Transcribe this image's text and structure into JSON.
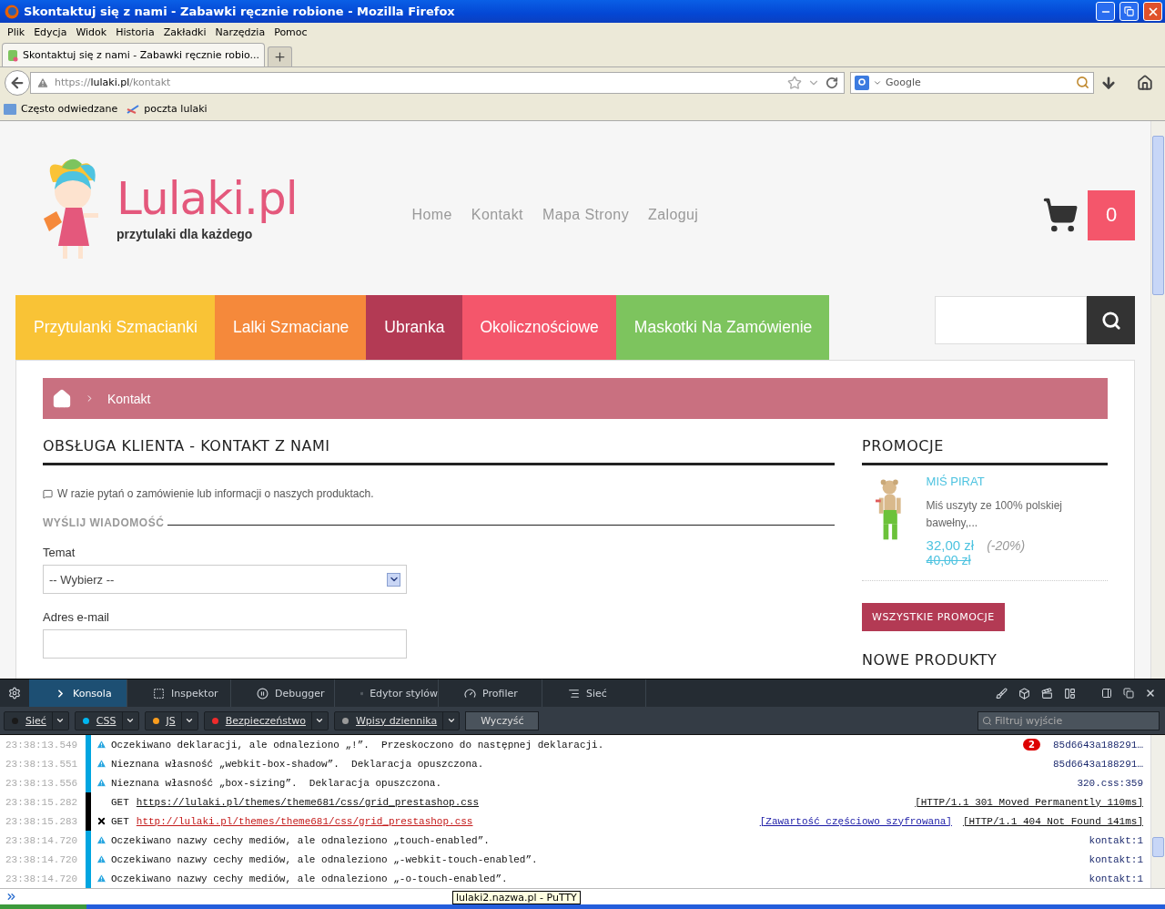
{
  "window": {
    "title": "Skontaktuj się z nami - Zabawki ręcznie robione - Mozilla Firefox"
  },
  "menu": [
    "Plik",
    "Edycja",
    "Widok",
    "Historia",
    "Zakładki",
    "Narzędzia",
    "Pomoc"
  ],
  "tabs": [
    {
      "label": "Skontaktuj się z nami - Zabawki ręcznie robio...",
      "selected": true
    }
  ],
  "address_bar": {
    "scheme": "https://",
    "host": "lulaki.pl",
    "path": "/kontakt"
  },
  "search_bar": {
    "placeholder": "Google"
  },
  "bookmarks": [
    "Często odwiedzane",
    "poczta lulaki"
  ],
  "page": {
    "logo": {
      "name": "Lulaki.pl",
      "tagline": "przytulaki dla każdego"
    },
    "nav": [
      "Home",
      "Kontakt",
      "Mapa Strony",
      "Zaloguj"
    ],
    "cart_count": "0",
    "categories": [
      {
        "label": "Przytulanki Szmacianki",
        "color": "#f9c336"
      },
      {
        "label": "Lalki Szmaciane",
        "color": "#f5893b"
      },
      {
        "label": "Ubranka",
        "color": "#b33a54"
      },
      {
        "label": "Okolicznościowe",
        "color": "#f4566b"
      },
      {
        "label": "Maskotki Na Zamówienie",
        "color": "#7dc45e"
      }
    ],
    "breadcrumb": [
      "Kontakt"
    ],
    "heading": "OBSŁUGA KLIENTA - KONTAKT Z NAMI",
    "intro": "W razie pytań o zamówienie lub informacji o naszych produktach.",
    "form_section": "WYŚLIJ WIADOMOŚĆ",
    "fields": [
      {
        "kind": "select",
        "label": "Temat",
        "value": "-- Wybierz --"
      },
      {
        "kind": "text",
        "label": "Adres e-mail"
      }
    ],
    "sidebar": {
      "title": "PROMOCJE",
      "product": {
        "name": "MIŚ PIRAT",
        "description": "Miś uszyty ze 100% polskiej bawełny,...",
        "price": "32,00 zł",
        "discount": "(-20%)",
        "old_price": "40,00 zł"
      },
      "button": "WSZYSTKIE PROMOCJE",
      "next_title": "NOWE PRODUKTY"
    }
  },
  "devtools": {
    "tabs": [
      {
        "label": "Konsola",
        "selected": true
      },
      {
        "label": "Inspektor",
        "selected": false
      },
      {
        "label": "Debugger",
        "selected": false
      },
      {
        "label": "Edytor stylów",
        "selected": false
      },
      {
        "label": "Profiler",
        "selected": false
      },
      {
        "label": "Sieć",
        "selected": false
      }
    ],
    "filters": [
      {
        "label": "Sieć",
        "color": "#1a1a1a"
      },
      {
        "label": "CSS",
        "color": "#00b6f0"
      },
      {
        "label": "JS",
        "color": "#fa9d1e"
      },
      {
        "label": "Bezpieczeństwo",
        "color": "#ef2b2b"
      },
      {
        "label": "Wpisy dziennika",
        "color": "#9a9a9a"
      }
    ],
    "clear": "Wyczyść",
    "filter_placeholder": "Filtruj wyjście",
    "rows": [
      {
        "kind": "warning",
        "time": "23:38:13.549",
        "message": "Oczekiwano deklaracji, ale odnaleziono „!”.  Przeskoczono do następnej deklaracji.",
        "badge": "2",
        "source": "85d6643a188291…"
      },
      {
        "kind": "warning",
        "time": "23:38:13.551",
        "message": "Nieznana własność „webkit-box-shadow”.  Deklaracja opuszczona.",
        "source": "85d6643a188291…"
      },
      {
        "kind": "warning",
        "time": "23:38:13.556",
        "message": "Nieznana własność „box-sizing”.  Deklaracja opuszczona.",
        "source": "320.css:359"
      },
      {
        "kind": "network",
        "time": "23:38:15.282",
        "method": "GET",
        "url": "https://lulaki.pl/themes/theme681/css/grid_prestashop.css",
        "status": "[HTTP/1.1 301 Moved Permanently 110ms]"
      },
      {
        "kind": "network-error",
        "time": "23:38:15.283",
        "method": "GET",
        "url": "http://lulaki.pl/themes/theme681/css/grid_prestashop.css",
        "note": "[Zawartość częściowo szyfrowana]",
        "status": "[HTTP/1.1 404 Not Found 141ms]"
      },
      {
        "kind": "warning",
        "time": "23:38:14.720",
        "message": "Oczekiwano nazwy cechy mediów, ale odnaleziono „touch-enabled”.",
        "source": "kontakt:1"
      },
      {
        "kind": "warning",
        "time": "23:38:14.720",
        "message": "Oczekiwano nazwy cechy mediów, ale odnaleziono „-webkit-touch-enabled”.",
        "source": "kontakt:1"
      },
      {
        "kind": "warning",
        "time": "23:38:14.720",
        "message": "Oczekiwano nazwy cechy mediów, ale odnaleziono „-o-touch-enabled”.",
        "source": "kontakt:1"
      }
    ]
  },
  "tooltip": "lulaki2.nazwa.pl - PuTTY"
}
